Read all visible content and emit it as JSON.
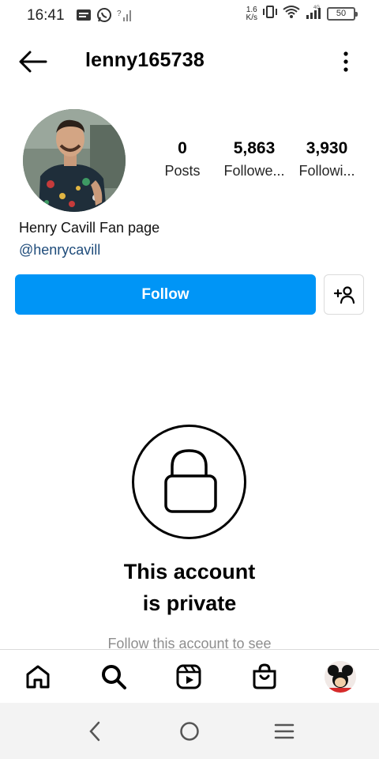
{
  "status_bar": {
    "time": "16:41",
    "speed_value": "1.6",
    "speed_unit": "K/s",
    "battery": "50",
    "network": "4G"
  },
  "header": {
    "username": "lenny165738"
  },
  "profile": {
    "stats": [
      {
        "value": "0",
        "label": "Posts"
      },
      {
        "value": "5,863",
        "label": "Followe..."
      },
      {
        "value": "3,930",
        "label": "Followi..."
      }
    ],
    "bio_name": "Henry Cavill Fan page",
    "bio_handle": "@henrycavill"
  },
  "actions": {
    "follow_label": "Follow"
  },
  "private": {
    "title_line1": "This account",
    "title_line2": "is private",
    "subtitle": "Follow this account to see"
  },
  "colors": {
    "accent": "#0095f6",
    "link": "#1e4b7a",
    "muted": "#8e8e8e"
  },
  "icons": {
    "nav": [
      "home-icon",
      "search-icon",
      "reels-icon",
      "shop-icon",
      "profile-avatar"
    ],
    "system": [
      "back-triangle-icon",
      "home-circle-icon",
      "menu-lines-icon"
    ]
  }
}
